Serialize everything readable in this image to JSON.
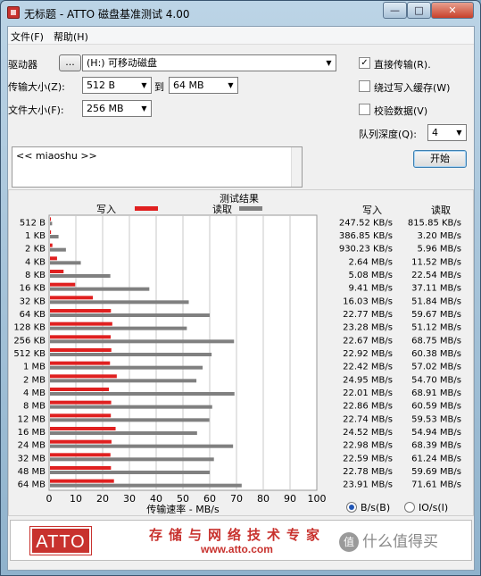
{
  "window": {
    "title": "无标题 - ATTO 磁盘基准测试 4.00",
    "min": "—",
    "max": "□",
    "close": "✕"
  },
  "menu": {
    "file": "文件(F)",
    "help": "帮助(H)"
  },
  "settings": {
    "drive_label": "驱动器",
    "drive_browse": "...",
    "drive_value": "(H:) 可移动磁盘",
    "transfer_label": "传输大小(Z):",
    "transfer_from": "512 B",
    "transfer_to_label": "到",
    "transfer_to": "64 MB",
    "file_size_label": "文件大小(F):",
    "file_size": "256 MB",
    "direct_io_label": "直接传输(R).",
    "direct_io_checked": true,
    "bypass_cache_label": "绕过写入缓存(W)",
    "bypass_cache_checked": false,
    "verify_label": "校验数据(V)",
    "verify_checked": false,
    "queue_label": "队列深度(Q):",
    "queue_value": "4",
    "start_button": "开始"
  },
  "description": {
    "text": "<< miaoshu >>"
  },
  "results": {
    "title": "测试结果",
    "write_legend": "写入",
    "read_legend": "读取",
    "col_write": "写入",
    "col_read": "读取",
    "xlabel": "传输速率 - MB/s",
    "unit_bs": "B/s(B)",
    "unit_ios": "IO/s(I)",
    "unit_selected": "B/s(B)",
    "write_values_text": [
      "247.52 KB/s",
      "386.85 KB/s",
      "930.23 KB/s",
      "2.64 MB/s",
      "5.08 MB/s",
      "9.41 MB/s",
      "16.03 MB/s",
      "22.77 MB/s",
      "23.28 MB/s",
      "22.67 MB/s",
      "22.92 MB/s",
      "22.42 MB/s",
      "24.95 MB/s",
      "22.01 MB/s",
      "22.86 MB/s",
      "22.74 MB/s",
      "24.52 MB/s",
      "22.98 MB/s",
      "22.59 MB/s",
      "22.78 MB/s",
      "23.91 MB/s"
    ],
    "read_values_text": [
      "815.85 KB/s",
      "3.20 MB/s",
      "5.96 MB/s",
      "11.52 MB/s",
      "22.54 MB/s",
      "37.11 MB/s",
      "51.84 MB/s",
      "59.67 MB/s",
      "51.12 MB/s",
      "68.75 MB/s",
      "60.38 MB/s",
      "57.02 MB/s",
      "54.70 MB/s",
      "68.91 MB/s",
      "60.59 MB/s",
      "59.53 MB/s",
      "54.94 MB/s",
      "68.39 MB/s",
      "61.24 MB/s",
      "59.69 MB/s",
      "71.61 MB/s"
    ]
  },
  "chart_data": {
    "type": "bar",
    "orientation": "horizontal",
    "categories": [
      "512 B",
      "1 KB",
      "2 KB",
      "4 KB",
      "8 KB",
      "16 KB",
      "32 KB",
      "64 KB",
      "128 KB",
      "256 KB",
      "512 KB",
      "1 MB",
      "2 MB",
      "4 MB",
      "8 MB",
      "12 MB",
      "16 MB",
      "24 MB",
      "32 MB",
      "48 MB",
      "64 MB"
    ],
    "series": [
      {
        "name": "写入",
        "color": "#e02020",
        "values": [
          0.24,
          0.38,
          0.91,
          2.64,
          5.08,
          9.41,
          16.03,
          22.77,
          23.28,
          22.67,
          22.92,
          22.42,
          24.95,
          22.01,
          22.86,
          22.74,
          24.52,
          22.98,
          22.59,
          22.78,
          23.91
        ]
      },
      {
        "name": "读取",
        "color": "#808080",
        "values": [
          0.8,
          3.2,
          5.96,
          11.52,
          22.54,
          37.11,
          51.84,
          59.67,
          51.12,
          68.75,
          60.38,
          57.02,
          54.7,
          68.91,
          60.59,
          59.53,
          54.94,
          68.39,
          61.24,
          59.69,
          71.61
        ]
      }
    ],
    "xlim": [
      0,
      100
    ],
    "xticks": [
      0,
      10,
      20,
      30,
      40,
      50,
      60,
      70,
      80,
      90,
      100
    ],
    "xlabel": "传输速率 - MB/s",
    "grid": true,
    "legend": "top"
  },
  "banner": {
    "logo": "ATTO",
    "slogan": "存储与网络技术专家",
    "url": "www.atto.com",
    "watermark": "什么值得买",
    "watermark_icon": "值"
  }
}
